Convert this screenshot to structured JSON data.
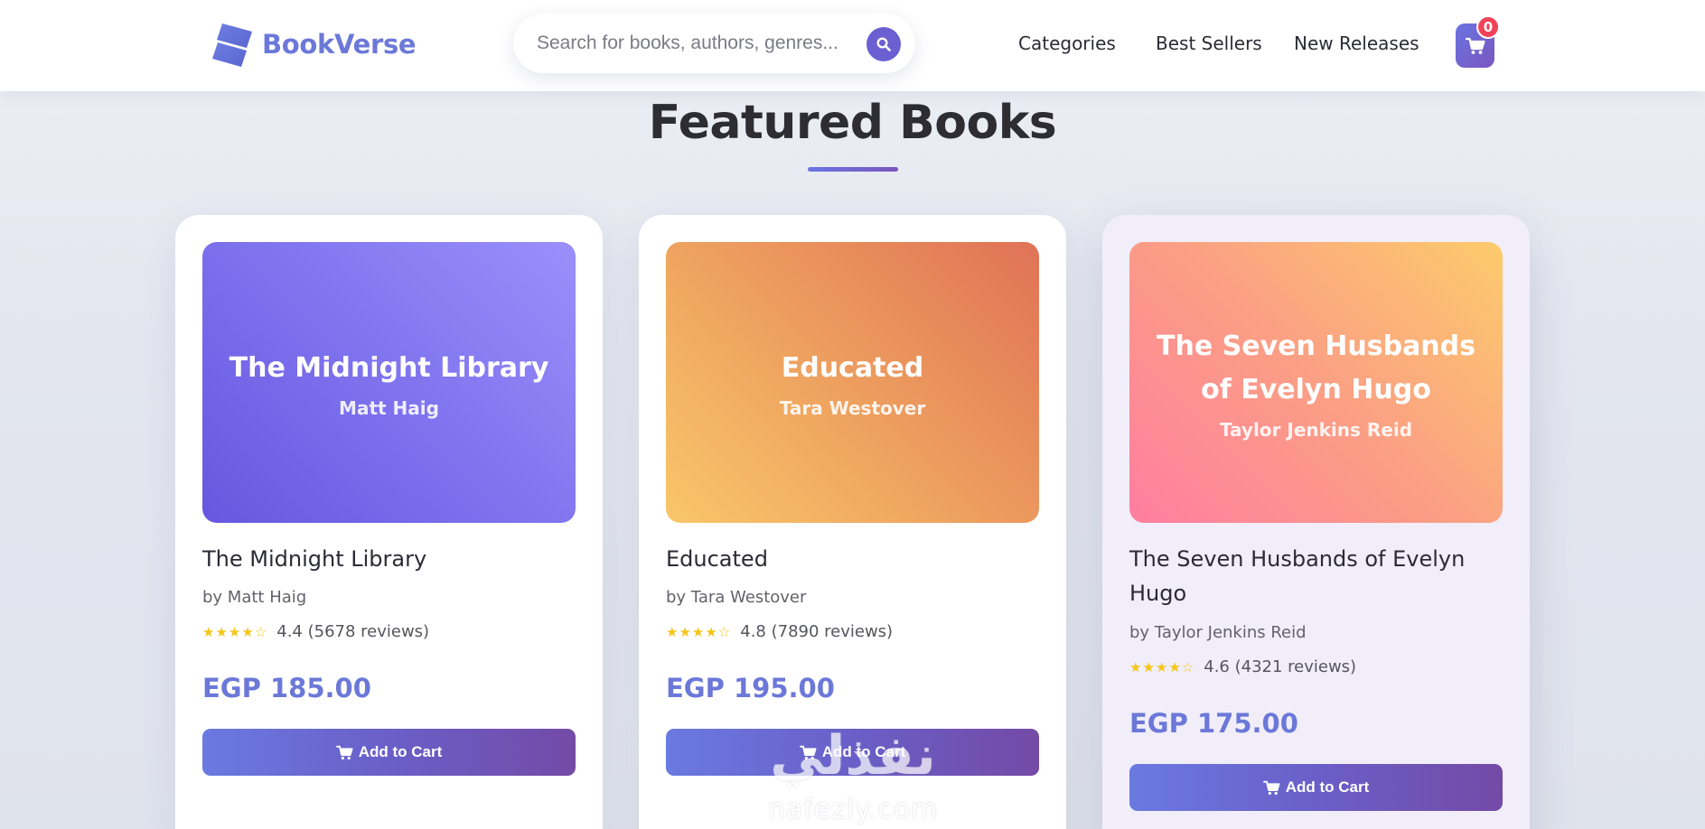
{
  "header": {
    "brand": "BookVerse",
    "search": {
      "placeholder": "Search for books, authors, genres...",
      "value": ""
    },
    "nav": [
      "Categories",
      "Best Sellers",
      "New Releases"
    ],
    "cart_count": "0"
  },
  "section": {
    "title": "Featured Books"
  },
  "books": [
    {
      "cover_title": "The Midnight Library",
      "cover_author": "Matt Haig",
      "title": "The Midnight Library",
      "author": "by Matt Haig",
      "stars": "★★★★☆",
      "rating_text": "4.4 (5678 reviews)",
      "price": "EGP 185.00",
      "button": "Add to Cart"
    },
    {
      "cover_title": "Educated",
      "cover_author": "Tara Westover",
      "title": "Educated",
      "author": "by Tara Westover",
      "stars": "★★★★☆",
      "rating_text": "4.8 (7890 reviews)",
      "price": "EGP 195.00",
      "button": "Add to Cart"
    },
    {
      "cover_title": "The Seven Husbands of Evelyn Hugo",
      "cover_author": "Taylor Jenkins Reid",
      "title": "The Seven Husbands of Evelyn Hugo",
      "author": "by Taylor Jenkins Reid",
      "stars": "★★★★☆",
      "rating_text": "4.6 (4321 reviews)",
      "price": "EGP 175.00",
      "button": "Add to Cart"
    }
  ],
  "watermark": {
    "arabic": "نفذلي",
    "latin": "nafezly.com"
  },
  "colors": {
    "brand": "#6c78d8",
    "button_start": "#6a7ae0",
    "button_end": "#744aa6",
    "badge": "#f0435a",
    "stars": "#f5c518"
  },
  "icons": [
    "book-logo-icon",
    "search-icon",
    "cart-icon"
  ]
}
